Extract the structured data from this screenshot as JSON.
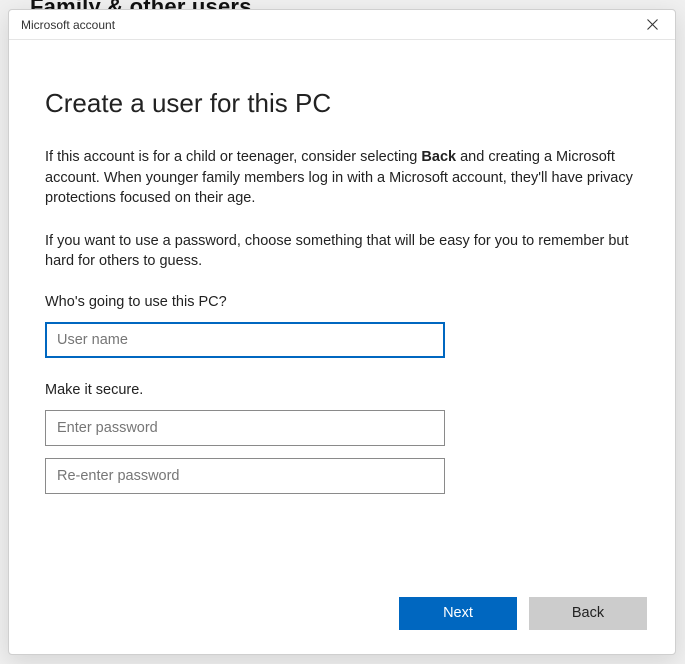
{
  "background_heading": "Family & other users",
  "titlebar": {
    "title": "Microsoft account"
  },
  "heading": "Create a user for this PC",
  "paragraph1_a": "If this account is for a child or teenager, consider selecting ",
  "paragraph1_bold": "Back",
  "paragraph1_b": " and creating a Microsoft account. When younger family members log in with a Microsoft account, they'll have privacy protections focused on their age.",
  "paragraph2": "If you want to use a password, choose something that will be easy for you to remember but hard for others to guess.",
  "username_section_label": "Who's going to use this PC?",
  "username_placeholder": "User name",
  "password_section_label": "Make it secure.",
  "password_placeholder": "Enter password",
  "confirm_password_placeholder": "Re-enter password",
  "buttons": {
    "next": "Next",
    "back": "Back"
  }
}
